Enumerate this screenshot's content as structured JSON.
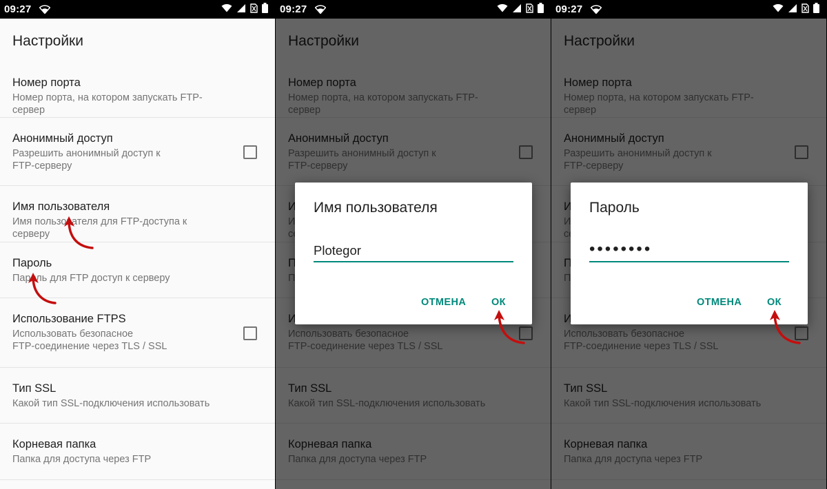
{
  "status_bar": {
    "time": "09:27"
  },
  "settings": {
    "title": "Настройки",
    "items": [
      {
        "title": "Номер порта",
        "summary": "Номер порта, на котором запускать FTP-сервер",
        "checkbox": false
      },
      {
        "title": "Анонимный доступ",
        "summary": "Разрешить анонимный доступ к\nFTP-серверу",
        "checkbox": true
      },
      {
        "title": "Имя пользователя",
        "summary": "Имя пользователя для FTP-доступа к серверу",
        "checkbox": false
      },
      {
        "title": "Пароль",
        "summary": "Пароль для FTP доступ к серверу",
        "checkbox": false
      },
      {
        "title": "Использование FTPS",
        "summary": "Использовать безопасное\nFTP-соединение через TLS / SSL",
        "checkbox": true
      },
      {
        "title": "Тип SSL",
        "summary": "Какой тип SSL-подключения использовать",
        "checkbox": false
      },
      {
        "title": "Корневая папка",
        "summary": "Папка для доступа через FTP",
        "checkbox": false
      }
    ]
  },
  "dialogs": {
    "username": {
      "title": "Имя пользователя",
      "value": "Plotegor",
      "cancel": "ОТМЕНА",
      "ok": "ОК"
    },
    "password": {
      "title": "Пароль",
      "value": "••••••••",
      "cancel": "ОТМЕНА",
      "ok": "ОК"
    }
  },
  "icons": {
    "wifi": "wifi-icon",
    "signal": "cell-signal-icon",
    "no_sim": "no-sim-icon",
    "battery": "battery-icon",
    "annotation": "red-arrow-annotation"
  },
  "colors": {
    "accent": "#00897b",
    "annotation": "#c40e0e",
    "status_bar": "#000000",
    "background": "#fafafa"
  }
}
